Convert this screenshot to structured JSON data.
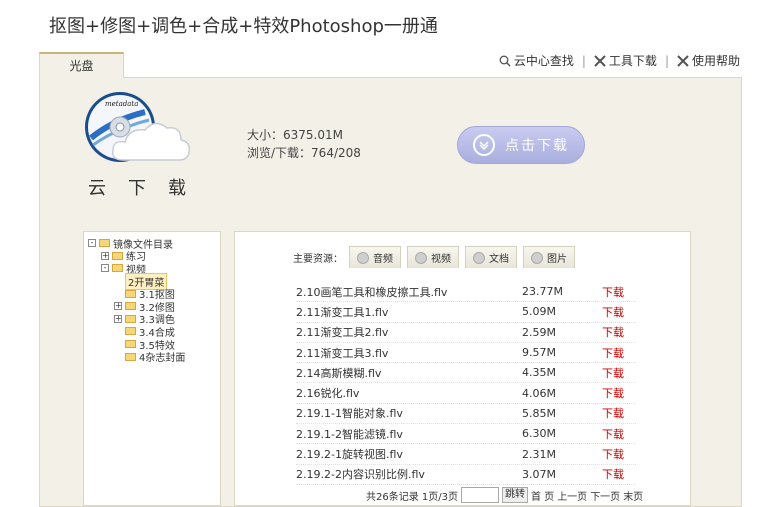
{
  "title": "抠图+修图+调色+合成+特效Photoshop一册通",
  "tab_label": "光盘",
  "toplinks": [
    {
      "label": "云中心查找",
      "icon": "search-icon"
    },
    {
      "label": "工具下载",
      "icon": "tools-icon"
    },
    {
      "label": "使用帮助",
      "icon": "help-icon"
    }
  ],
  "logo_text": "metadata",
  "cloud_title": "云下载",
  "meta": {
    "size": "大小：6375.01M",
    "views": "浏览/下载：764/208"
  },
  "download_button": "点击下载",
  "tree": [
    {
      "label": "镜像文件目录",
      "level": 0,
      "toggle": "-"
    },
    {
      "label": "练习",
      "level": 1,
      "toggle": "+"
    },
    {
      "label": "视频",
      "level": 1,
      "toggle": "-"
    },
    {
      "label": "2开胃菜",
      "level": 2,
      "toggle": "",
      "selected": true
    },
    {
      "label": "3.1抠图",
      "level": 2,
      "toggle": ""
    },
    {
      "label": "3.2修图",
      "level": 2,
      "toggle": "+"
    },
    {
      "label": "3.3调色",
      "level": 2,
      "toggle": "+"
    },
    {
      "label": "3.4合成",
      "level": 2,
      "toggle": ""
    },
    {
      "label": "3.5特效",
      "level": 2,
      "toggle": ""
    },
    {
      "label": "4杂志封面",
      "level": 2,
      "toggle": ""
    }
  ],
  "resources": {
    "label": "主要资源：",
    "tabs": [
      "音频",
      "视频",
      "文档",
      "图片"
    ]
  },
  "files": [
    {
      "name": "2.10画笔工具和橡皮擦工具.flv",
      "size": "23.77M",
      "action": "下载"
    },
    {
      "name": "2.11渐变工具1.flv",
      "size": "5.09M",
      "action": "下载"
    },
    {
      "name": "2.11渐变工具2.flv",
      "size": "2.59M",
      "action": "下载"
    },
    {
      "name": "2.11渐变工具3.flv",
      "size": "9.57M",
      "action": "下载"
    },
    {
      "name": "2.14高斯模糊.flv",
      "size": "4.35M",
      "action": "下载"
    },
    {
      "name": "2.16锐化.flv",
      "size": "4.06M",
      "action": "下载"
    },
    {
      "name": "2.19.1-1智能对象.flv",
      "size": "5.85M",
      "action": "下载"
    },
    {
      "name": "2.19.1-2智能滤镜.flv",
      "size": "6.30M",
      "action": "下载"
    },
    {
      "name": "2.19.2-1旋转视图.flv",
      "size": "2.31M",
      "action": "下载"
    },
    {
      "name": "2.19.2-2内容识别比例.flv",
      "size": "3.07M",
      "action": "下载"
    }
  ],
  "pager": {
    "summary": "共26条记录 1页/3页",
    "input_value": "",
    "go": "跳转",
    "first": "首 页",
    "prev": "上一页",
    "next": "下一页",
    "last": "末页"
  }
}
